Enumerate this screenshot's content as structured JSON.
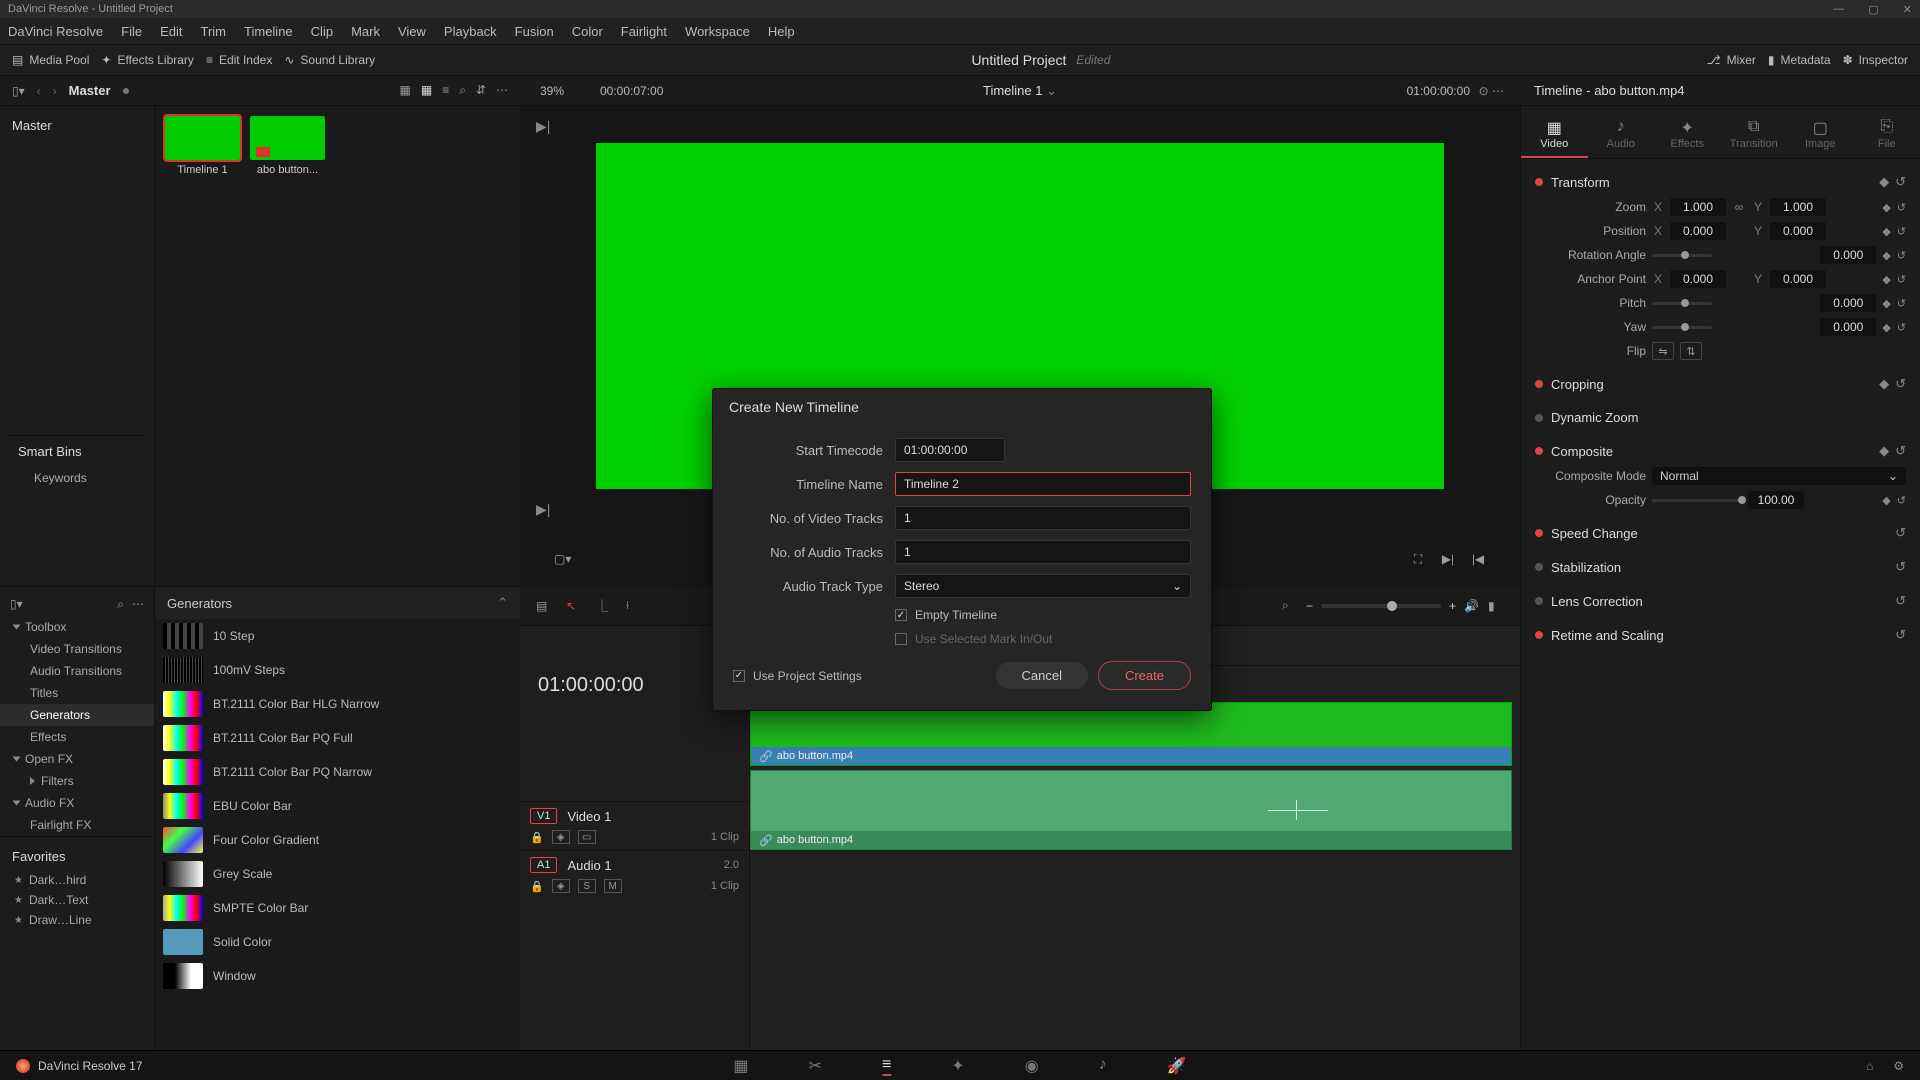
{
  "titlebar": {
    "app": "DaVinci Resolve",
    "project": "Untitled Project"
  },
  "menu": [
    "DaVinci Resolve",
    "File",
    "Edit",
    "Trim",
    "Timeline",
    "Clip",
    "Mark",
    "View",
    "Playback",
    "Fusion",
    "Color",
    "Fairlight",
    "Workspace",
    "Help"
  ],
  "toolbar": {
    "media_pool": "Media Pool",
    "effects_lib": "Effects Library",
    "edit_index": "Edit Index",
    "sound_lib": "Sound Library",
    "mixer": "Mixer",
    "metadata": "Metadata",
    "inspector": "Inspector",
    "project_name": "Untitled Project",
    "edited": "Edited"
  },
  "subbar": {
    "master": "Master",
    "zoom": "39%",
    "src_tc": "00:00:07:00",
    "timeline_name": "Timeline 1",
    "rec_tc": "01:00:00:00",
    "inspector_title": "Timeline - abo button.mp4"
  },
  "bins": {
    "master": "Master",
    "clips": [
      {
        "name": "Timeline 1",
        "selected": true
      },
      {
        "name": "abo button...",
        "selected": false
      }
    ],
    "smart_bins_hdr": "Smart Bins",
    "smart_bins": [
      "Keywords"
    ]
  },
  "fx": {
    "tree": {
      "toolbox": "Toolbox",
      "children": [
        "Video Transitions",
        "Audio Transitions",
        "Titles",
        "Generators",
        "Effects"
      ],
      "openfx": "Open FX",
      "openfx_children": [
        "Filters"
      ],
      "audiofx": "Audio FX",
      "audiofx_children": [
        "Fairlight FX"
      ]
    },
    "list_header": "Generators",
    "items": [
      {
        "label": "10 Step",
        "sw": "sw-step"
      },
      {
        "label": "100mV Steps",
        "sw": "sw-100mv"
      },
      {
        "label": "BT.2111 Color Bar HLG Narrow",
        "sw": "sw-bars"
      },
      {
        "label": "BT.2111 Color Bar PQ Full",
        "sw": "sw-bars"
      },
      {
        "label": "BT.2111 Color Bar PQ Narrow",
        "sw": "sw-bars"
      },
      {
        "label": "EBU Color Bar",
        "sw": "sw-ebu"
      },
      {
        "label": "Four Color Gradient",
        "sw": "sw-4c"
      },
      {
        "label": "Grey Scale",
        "sw": "sw-grey"
      },
      {
        "label": "SMPTE Color Bar",
        "sw": "sw-smpte"
      },
      {
        "label": "Solid Color",
        "sw": "sw-solid"
      },
      {
        "label": "Window",
        "sw": "sw-win"
      }
    ],
    "favorites_hdr": "Favorites",
    "favorites": [
      "Dark…hird",
      "Dark…Text",
      "Draw…Line"
    ]
  },
  "timeline": {
    "big_tc": "01:00:00:00",
    "v1": {
      "tag": "V1",
      "name": "Video 1",
      "clips": "1 Clip"
    },
    "a1": {
      "tag": "A1",
      "name": "Audio 1",
      "ch": "2.0",
      "clips": "1 Clip"
    },
    "clip_name": "abo button.mp4"
  },
  "inspector": {
    "tabs": [
      "Video",
      "Audio",
      "Effects",
      "Transition",
      "Image",
      "File"
    ],
    "transform": {
      "title": "Transform",
      "zoom": "Zoom",
      "zoom_x": "1.000",
      "zoom_y": "1.000",
      "position": "Position",
      "pos_x": "0.000",
      "pos_y": "0.000",
      "rotation": "Rotation Angle",
      "rot_v": "0.000",
      "anchor": "Anchor Point",
      "anc_x": "0.000",
      "anc_y": "0.000",
      "pitch": "Pitch",
      "pitch_v": "0.000",
      "yaw": "Yaw",
      "yaw_v": "0.000",
      "flip": "Flip"
    },
    "cropping": "Cropping",
    "dynzoom": "Dynamic Zoom",
    "composite": {
      "title": "Composite",
      "mode_lbl": "Composite Mode",
      "mode": "Normal",
      "opacity_lbl": "Opacity",
      "opacity": "100.00"
    },
    "speed": "Speed Change",
    "stab": "Stabilization",
    "lens": "Lens Correction",
    "retime": "Retime and Scaling"
  },
  "modal": {
    "title": "Create New Timeline",
    "start_tc_lbl": "Start Timecode",
    "start_tc": "01:00:00:00",
    "name_lbl": "Timeline Name",
    "name": "Timeline 2",
    "vtracks_lbl": "No. of Video Tracks",
    "vtracks": "1",
    "atracks_lbl": "No. of Audio Tracks",
    "atracks": "1",
    "atype_lbl": "Audio Track Type",
    "atype": "Stereo",
    "empty": "Empty Timeline",
    "use_sel": "Use Selected Mark In/Out",
    "use_proj": "Use Project Settings",
    "cancel": "Cancel",
    "create": "Create"
  },
  "footer": {
    "brand": "DaVinci Resolve 17"
  }
}
